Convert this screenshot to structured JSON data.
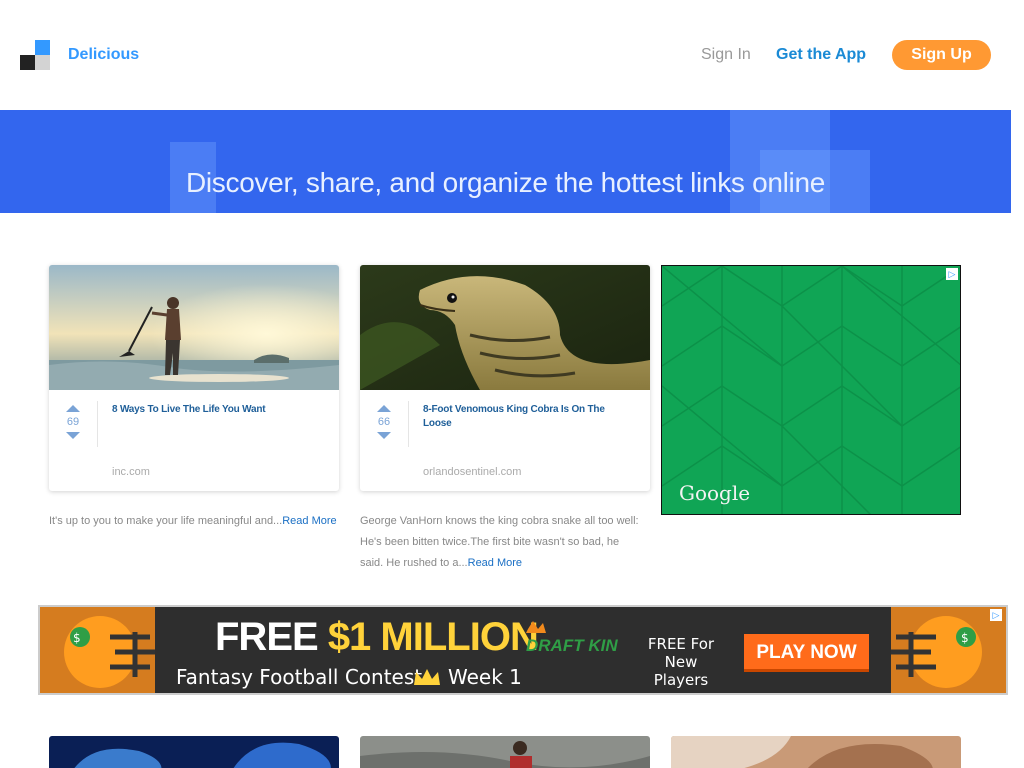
{
  "header": {
    "brand": "Delicious",
    "sign_in": "Sign In",
    "get_app": "Get the App",
    "sign_up": "Sign Up"
  },
  "hero": {
    "title": "Discover, share, and organize the hottest links online"
  },
  "cards": [
    {
      "votes": "69",
      "title": "8 Ways To Live The Life You Want",
      "source": "inc.com",
      "description": "It's up to you to make your life meaningful and...",
      "read_more": "Read More"
    },
    {
      "votes": "66",
      "title": "8-Foot Venomous King Cobra Is On The Loose",
      "source": "orlandosentinel.com",
      "description": "George VanHorn knows the king cobra snake all too well: He's been bitten twice.The first bite wasn't so bad, he said. He rushed to a...",
      "read_more": "Read More"
    }
  ],
  "google_ad": {
    "label": "Google"
  },
  "banner_ad": {
    "headline_free": "FREE",
    "headline_amount": "$1 MILLION",
    "subline": "Fantasy Football Contest",
    "week": "Week 1",
    "brand": "DRAFT KINGS",
    "offer": "FREE For New Players",
    "cta": "PLAY NOW"
  },
  "colors": {
    "accent": "#3399ff",
    "signup": "#ff9933",
    "hero": "#3366ee",
    "ad_green": "#10a555"
  }
}
